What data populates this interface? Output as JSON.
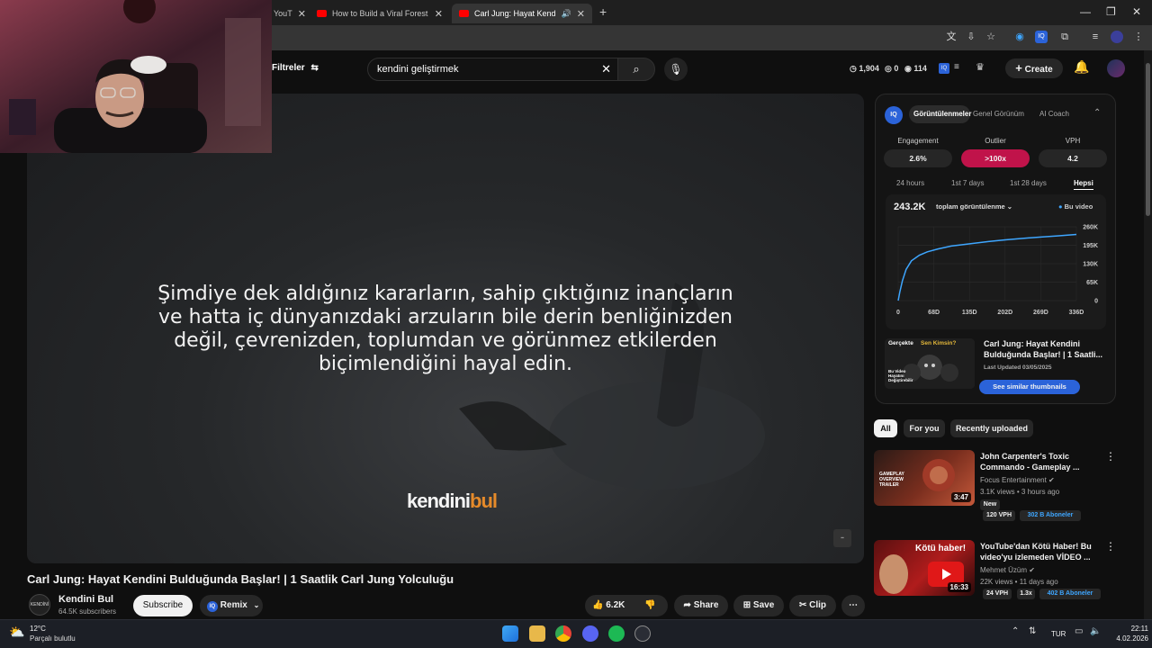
{
  "browser": {
    "tabs": [
      {
        "label": "YouT"
      },
      {
        "label": "How to Build a Viral Forest Surv"
      },
      {
        "label": "Carl Jung: Hayat Kendini Bul"
      }
    ],
    "new_tab": "+"
  },
  "header": {
    "filters_label": "Filtreler",
    "search_value": "kendini geliştirmek",
    "stats": {
      "watch": "1,904",
      "comments": "0",
      "views": "114"
    },
    "create_label": "Create"
  },
  "video": {
    "subtitle": "Şimdiye dek aldığınız kararların, sahip çıktığınız inançların ve hatta iç dünyanızdaki arzuların bile derin benliğinizden değil, çevrenizden, toplumdan ve görünmez etkilerden biçimlendiğini hayal edin.",
    "brand_main": "kendini",
    "brand_accent": "bul",
    "title": "Carl Jung: Hayat Kendini Bulduğunda Başlar! | 1 Saatlik Carl Jung Yolculuğu",
    "channel": "Kendini Bul",
    "subscribers": "64.5K subscribers",
    "subscribe_label": "Subscribe",
    "remix_label": "Remix",
    "likes": "6.2K",
    "share_label": "Share",
    "save_label": "Save",
    "clip_label": "Clip"
  },
  "iq_panel": {
    "tabs": [
      "Görüntülenmeler",
      "Genel Görünüm",
      "AI Coach"
    ],
    "metrics": [
      {
        "label": "Engagement",
        "value": "2.6%"
      },
      {
        "label": "Outlier",
        "value": ">100x"
      },
      {
        "label": "VPH",
        "value": "4.2"
      }
    ],
    "periods": [
      "24 hours",
      "1st 7 days",
      "1st 28 days",
      "Hepsi"
    ],
    "total_views": "243.2K",
    "views_dropdown": "toplam görüntülenme",
    "legend": "Bu video",
    "related_title": "Carl Jung: Hayat Kendini Bulduğunda Başlar! | 1 Saatli...",
    "related_updated": "Last Updated 03/05/2025",
    "similar_btn": "See similar thumbnails",
    "thumb_title_1": "Gerçekte",
    "thumb_title_2": "Sen Kimsin?",
    "thumb_caption": "Bu Video Hayatını Değiştirebilir"
  },
  "chart_data": {
    "type": "line",
    "title": "",
    "xlabel": "",
    "ylabel": "",
    "x_ticks": [
      "0",
      "68D",
      "135D",
      "202D",
      "269D",
      "336D"
    ],
    "y_ticks": [
      "0",
      "65K",
      "130K",
      "195K",
      "260K"
    ],
    "ylim": [
      0,
      260000
    ],
    "xlim": [
      0,
      336
    ],
    "series": [
      {
        "name": "Bu video",
        "x": [
          0,
          3,
          8,
          15,
          25,
          40,
          55,
          75,
          100,
          135,
          170,
          202,
          240,
          269,
          300,
          336
        ],
        "y": [
          0,
          30000,
          70000,
          110000,
          140000,
          160000,
          172000,
          182000,
          192000,
          200000,
          208000,
          214000,
          220000,
          224000,
          228000,
          233000
        ]
      }
    ],
    "color": "#3ea6ff",
    "grid": true
  },
  "chips": [
    "All",
    "For you",
    "Recently uploaded"
  ],
  "recommendations": [
    {
      "title": "John Carpenter's Toxic Commando - Gameplay ...",
      "channel": "Focus Entertainment",
      "meta": "3.1K views • 3 hours ago",
      "badge_new": "New",
      "vph": "120 VPH",
      "subs": "302 B Aboneler",
      "duration": "3:47",
      "thumb_text": "GAMEPLAY OVERVIEW TRAILER"
    },
    {
      "title": "YouTube'dan Kötü Haber! Bu video'yu izlemeden VİDEO ...",
      "channel": "Mehmet Üzüm",
      "meta": "22K views • 11 days ago",
      "vph": "24 VPH",
      "mult": "1.3x",
      "subs": "402 B Aboneler",
      "duration": "16:33",
      "thumb_text": "Kötü haber!"
    }
  ],
  "taskbar": {
    "temp": "12°C",
    "weather": "Parçalı bulutlu",
    "lang": "TUR",
    "time": "22:11",
    "date": "4.02.2026"
  },
  "colors": {
    "accent_blue": "#3ea6ff",
    "outlier": "#c0134a",
    "brand_orange": "#e58a2a"
  }
}
